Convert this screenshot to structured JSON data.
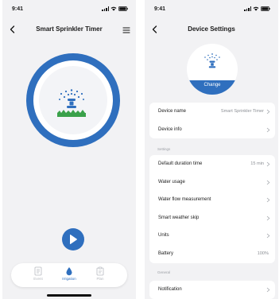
{
  "left_screen": {
    "status_time": "9:41",
    "title": "Smart Sprinkler Timer",
    "tabs": [
      {
        "label": "Event"
      },
      {
        "label": "Irrigation"
      },
      {
        "label": "Plan"
      }
    ],
    "active_tab": "Irrigation"
  },
  "right_screen": {
    "status_time": "9:41",
    "title": "Device Settings",
    "avatar_button": "Change",
    "device_rows": [
      {
        "label": "Device name",
        "value": "Smart Sprinkler Timer"
      },
      {
        "label": "Device info",
        "value": ""
      }
    ],
    "settings_section": "Settings",
    "settings_rows": [
      {
        "label": "Default duration time",
        "value": "15 min"
      },
      {
        "label": "Water usage",
        "value": ""
      },
      {
        "label": "Water flow measurement",
        "value": ""
      },
      {
        "label": "Smart weather skip",
        "value": ""
      },
      {
        "label": "Units",
        "value": ""
      },
      {
        "label": "Battery",
        "value": "100%"
      }
    ],
    "general_section": "General",
    "general_rows": [
      {
        "label": "Notification",
        "value": ""
      }
    ]
  },
  "colors": {
    "accent": "#2f6fbe",
    "background": "#f2f2f4",
    "grass": "#3aa14a",
    "muted": "#b7bac0"
  }
}
